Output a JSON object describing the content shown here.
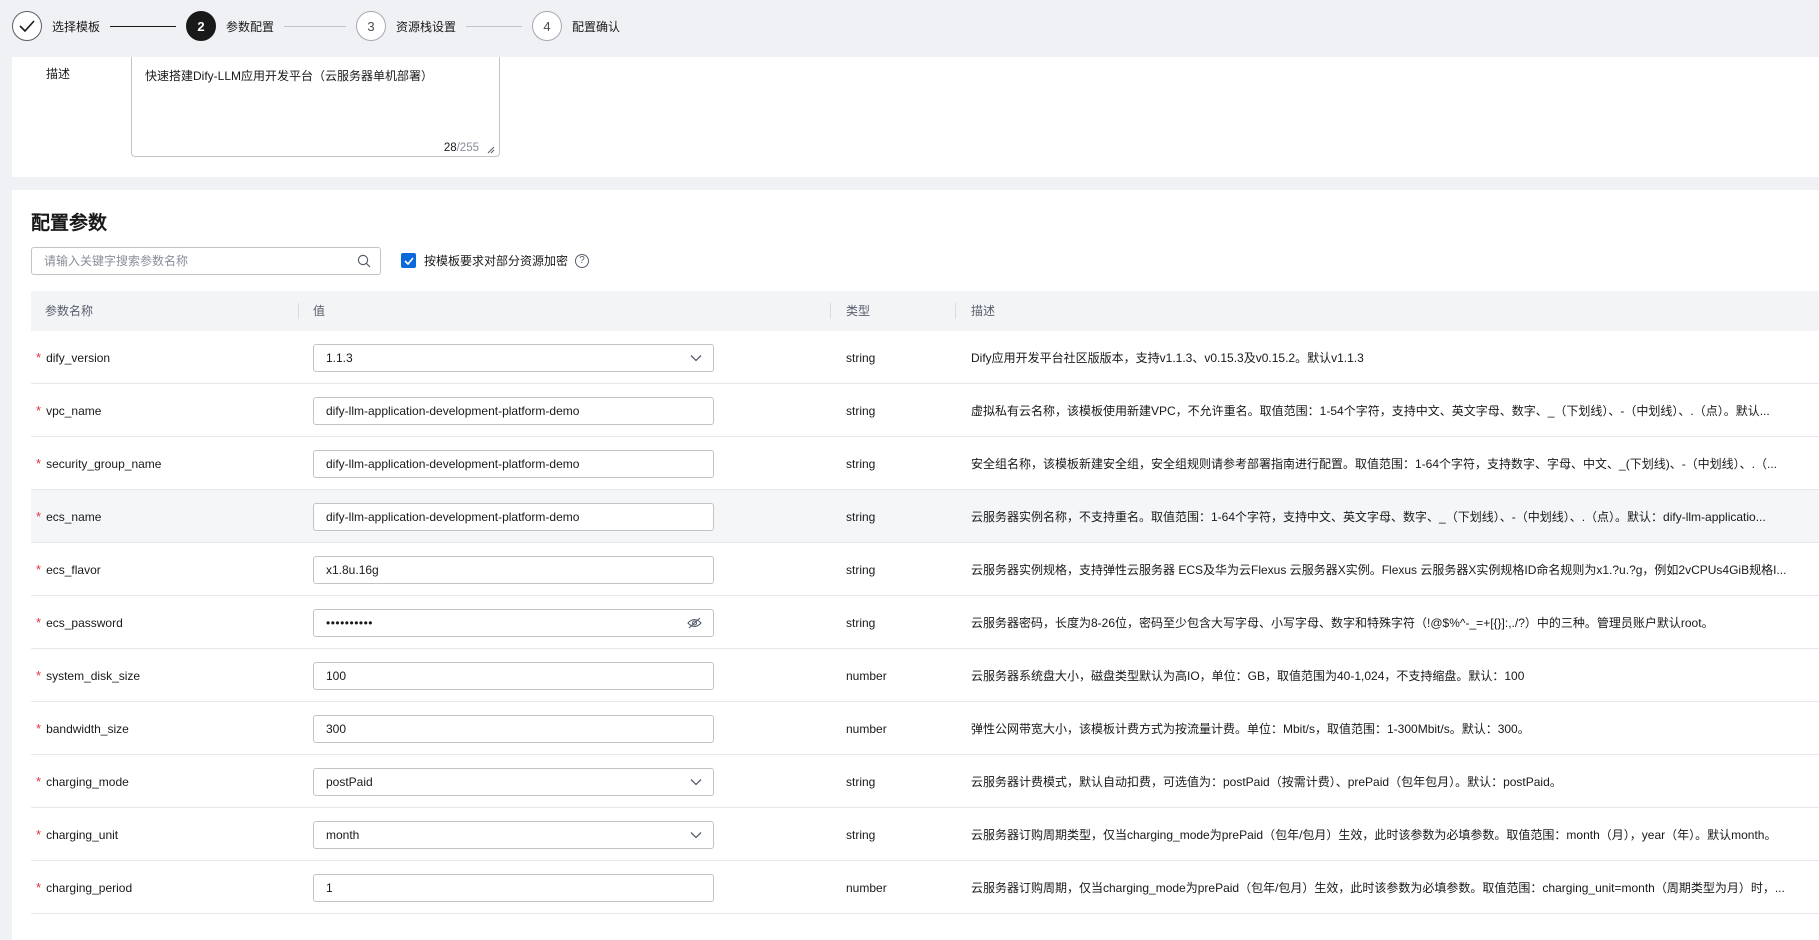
{
  "stepper": {
    "steps": [
      {
        "number": "",
        "label": "选择模板",
        "state": "done"
      },
      {
        "number": "2",
        "label": "参数配置",
        "state": "active"
      },
      {
        "number": "3",
        "label": "资源栈设置",
        "state": "pending"
      },
      {
        "number": "4",
        "label": "配置确认",
        "state": "pending"
      }
    ]
  },
  "description": {
    "label": "描述",
    "value": "快速搭建Dify-LLM应用开发平台（云服务器单机部署）",
    "count": "28",
    "max": "/255"
  },
  "config": {
    "title": "配置参数",
    "search_placeholder": "请输入关键字搜索参数名称",
    "encrypt_label": "按模板要求对部分资源加密",
    "encrypt_checked": true,
    "help": "?",
    "columns": {
      "name": "参数名称",
      "value": "值",
      "type": "类型",
      "desc": "描述"
    },
    "rows": [
      {
        "name": "dify_version",
        "value": "1.1.3",
        "kind": "select",
        "type": "string",
        "desc": "Dify应用开发平台社区版版本，支持v1.1.3、v0.15.3及v0.15.2。默认v1.1.3"
      },
      {
        "name": "vpc_name",
        "value": "dify-llm-application-development-platform-demo",
        "kind": "text",
        "type": "string",
        "desc": "虚拟私有云名称，该模板使用新建VPC，不允许重名。取值范围：1-54个字符，支持中文、英文字母、数字、_（下划线）、-（中划线）、.（点）。默认..."
      },
      {
        "name": "security_group_name",
        "value": "dify-llm-application-development-platform-demo",
        "kind": "text",
        "type": "string",
        "desc": "安全组名称，该模板新建安全组，安全组规则请参考部署指南进行配置。取值范围：1-64个字符，支持数字、字母、中文、_(下划线)、-（中划线）、.（..."
      },
      {
        "name": "ecs_name",
        "value": "dify-llm-application-development-platform-demo",
        "kind": "text",
        "type": "string",
        "desc": "云服务器实例名称，不支持重名。取值范围：1-64个字符，支持中文、英文字母、数字、_（下划线）、-（中划线）、.（点）。默认：dify-llm-applicatio..."
      },
      {
        "name": "ecs_flavor",
        "value": "x1.8u.16g",
        "kind": "text",
        "type": "string",
        "desc": "云服务器实例规格，支持弹性云服务器 ECS及华为云Flexus 云服务器X实例。Flexus 云服务器X实例规格ID命名规则为x1.?u.?g，例如2vCPUs4GiB规格I..."
      },
      {
        "name": "ecs_password",
        "value": "••••••••••",
        "kind": "password",
        "type": "string",
        "desc": "云服务器密码，长度为8-26位，密码至少包含大写字母、小写字母、数字和特殊字符（!@$%^-_=+[{}]:,./?）中的三种。管理员账户默认root。"
      },
      {
        "name": "system_disk_size",
        "value": "100",
        "kind": "text",
        "type": "number",
        "desc": "云服务器系统盘大小，磁盘类型默认为高IO，单位：GB，取值范围为40-1,024，不支持缩盘。默认：100"
      },
      {
        "name": "bandwidth_size",
        "value": "300",
        "kind": "text",
        "type": "number",
        "desc": "弹性公网带宽大小，该模板计费方式为按流量计费。单位：Mbit/s，取值范围：1-300Mbit/s。默认：300。"
      },
      {
        "name": "charging_mode",
        "value": "postPaid",
        "kind": "select",
        "type": "string",
        "desc": "云服务器计费模式，默认自动扣费，可选值为：postPaid（按需计费）、prePaid（包年包月）。默认：postPaid。"
      },
      {
        "name": "charging_unit",
        "value": "month",
        "kind": "select",
        "type": "string",
        "desc": "云服务器订购周期类型，仅当charging_mode为prePaid（包年/包月）生效，此时该参数为必填参数。取值范围：month（月），year（年）。默认month。"
      },
      {
        "name": "charging_period",
        "value": "1",
        "kind": "text",
        "type": "number",
        "desc": "云服务器订购周期，仅当charging_mode为prePaid（包年/包月）生效，此时该参数为必填参数。取值范围：charging_unit=month（周期类型为月）时，..."
      }
    ]
  },
  "colors": {
    "accent": "#0c69d9",
    "required": "#e6303c",
    "active_step": "#191919"
  }
}
